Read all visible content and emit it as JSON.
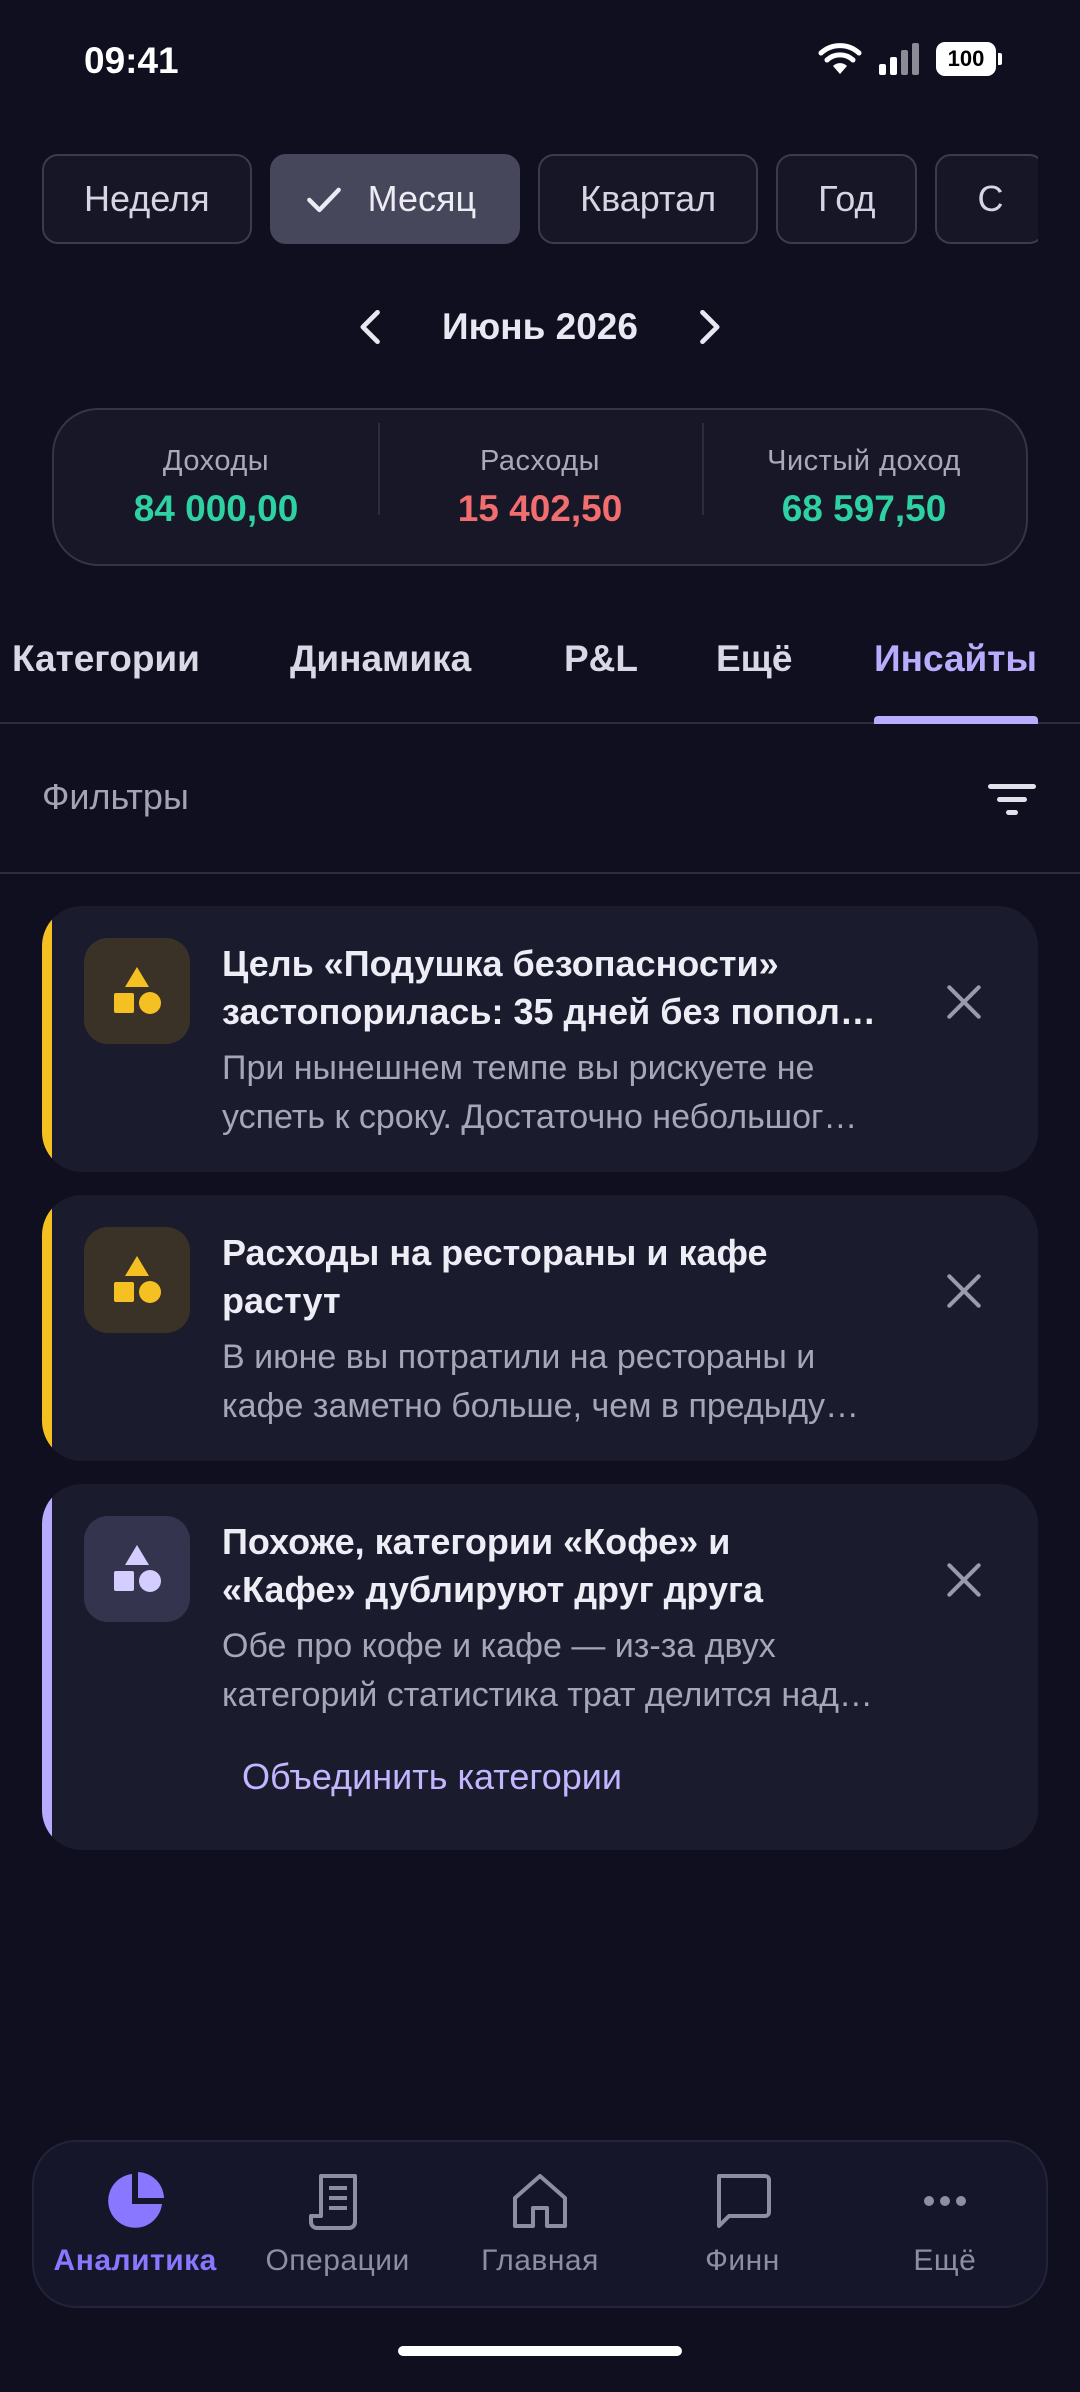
{
  "status_bar": {
    "time": "09:41",
    "battery": "100"
  },
  "periods": [
    {
      "label": "Неделя",
      "selected": false
    },
    {
      "label": "Месяц",
      "selected": true
    },
    {
      "label": "Квартал",
      "selected": false
    },
    {
      "label": "Год",
      "selected": false
    },
    {
      "label": "С",
      "selected": false
    }
  ],
  "month_nav": {
    "label": "Июнь 2026"
  },
  "summary": [
    {
      "label": "Доходы",
      "value": "84 000,00",
      "color": "#2ed1a2"
    },
    {
      "label": "Расходы",
      "value": "15 402,50",
      "color": "#f26d6d"
    },
    {
      "label": "Чистый доход",
      "value": "68 597,50",
      "color": "#2ed1a2"
    }
  ],
  "tabs": [
    {
      "label": "Категории",
      "active": false
    },
    {
      "label": "Динамика",
      "active": false
    },
    {
      "label": "P&L",
      "active": false
    },
    {
      "label": "Ещё",
      "active": false
    },
    {
      "label": "Инсайты",
      "active": true
    }
  ],
  "filters": {
    "label": "Фильтры"
  },
  "insights": [
    {
      "accent": "#f5c022",
      "icon": "shapes-icon",
      "title_lines": [
        "Цель «Подушка безопасности»",
        "застопорилась: 35 дней без попол…"
      ],
      "body_lines": [
        "При нынешнем темпе вы рискуете не",
        "успеть к сроку. Достаточно небольшог…"
      ]
    },
    {
      "accent": "#f5c022",
      "icon": "shapes-icon",
      "title_lines": [
        "Расходы на рестораны и кафе",
        "растут"
      ],
      "body_lines": [
        "В июне вы потратили на рестораны и",
        "кафе заметно больше, чем в предыду…"
      ]
    },
    {
      "accent": "#b8abff",
      "icon": "shapes-icon",
      "title_lines": [
        "Похоже, категории «Кофе» и",
        "«Кафе» дублируют друг друга"
      ],
      "body_lines": [
        "Обе про кофе и кафе — из-за двух",
        "категорий статистика трат делится над…"
      ],
      "action": "Объединить категории"
    }
  ],
  "bottom_nav": [
    {
      "label": "Аналитика",
      "icon": "pie-chart-icon",
      "active": true
    },
    {
      "label": "Операции",
      "icon": "receipt-icon",
      "active": false
    },
    {
      "label": "Главная",
      "icon": "home-icon",
      "active": false
    },
    {
      "label": "Финн",
      "icon": "chat-icon",
      "active": false
    },
    {
      "label": "Ещё",
      "icon": "more-icon",
      "active": false
    }
  ]
}
